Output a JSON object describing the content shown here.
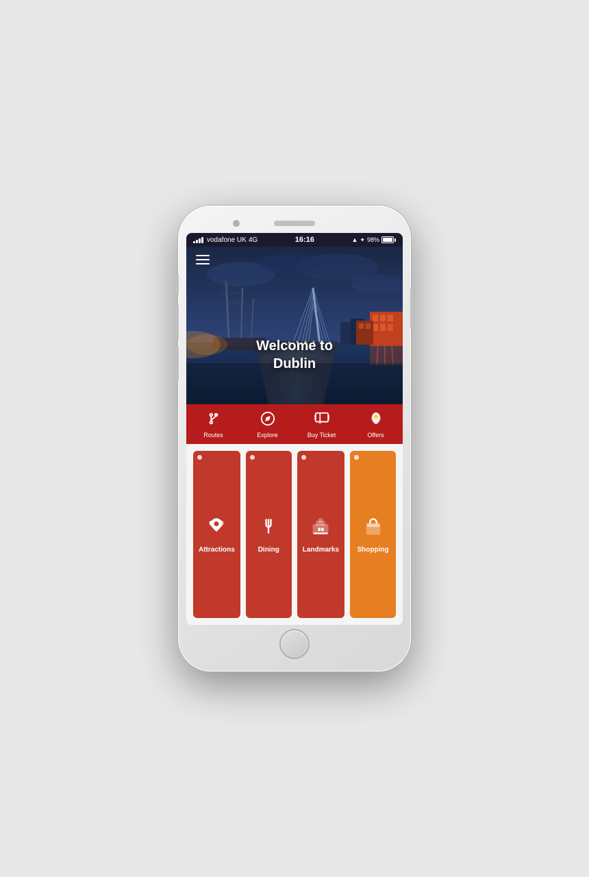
{
  "phone": {
    "status_bar": {
      "carrier": "vodafone UK",
      "network": "4G",
      "time": "16:16",
      "battery_percent": "98%"
    }
  },
  "app": {
    "hero": {
      "title_line1": "Welcome to",
      "title_line2": "Dublin"
    },
    "nav": {
      "items": [
        {
          "id": "routes",
          "label": "Routes",
          "icon": "🔀"
        },
        {
          "id": "explore",
          "label": "Explore",
          "icon": "🧭"
        },
        {
          "id": "buy-ticket",
          "label": "Buy Ticket",
          "icon": "🎟"
        },
        {
          "id": "offers",
          "label": "Offers",
          "icon": "🔥"
        }
      ]
    },
    "categories": [
      {
        "id": "attractions",
        "label": "Attractions",
        "color": "cat-attractions"
      },
      {
        "id": "dining",
        "label": "Dining",
        "color": "cat-dining"
      },
      {
        "id": "landmarks",
        "label": "Landmarks",
        "color": "cat-landmarks"
      },
      {
        "id": "shopping",
        "label": "Shopping",
        "color": "cat-shopping"
      }
    ]
  }
}
